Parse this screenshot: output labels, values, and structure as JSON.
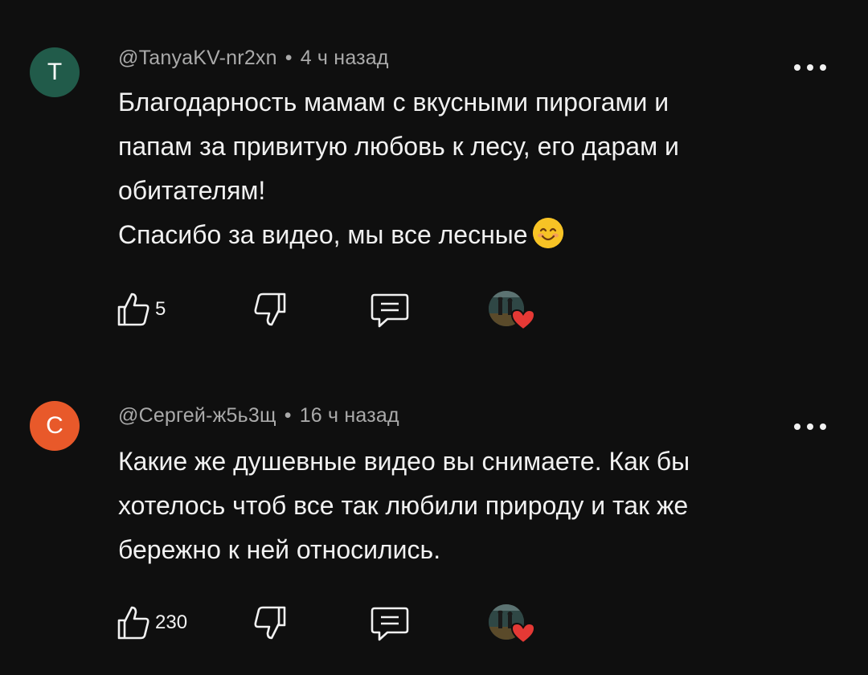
{
  "comments": [
    {
      "avatar_letter": "T",
      "avatar_color": "#215b4a",
      "author": "@TanyaKV-nr2xn",
      "separator": "•",
      "time": "4 ч назад",
      "lines": [
        "Благодарность мамам с вкусными пирогами и",
        "папам за привитую любовь к лесу, его дарам и",
        "обитателям!",
        "Спасибо за видео, мы все лесные"
      ],
      "emoji": "smiling-face-emoji",
      "likes": "5",
      "menu_icon": "more-vertical-icon",
      "like_icon": "thumbs-up-icon",
      "dislike_icon": "thumbs-down-icon",
      "reply_icon": "reply-icon"
    },
    {
      "avatar_letter": "C",
      "avatar_color": "#e8592a",
      "author": "@Сергей-ж5ь3щ",
      "separator": "•",
      "time": "16 ч назад",
      "lines": [
        "Какие же душевные видео вы снимаете. Как бы",
        "хотелось чтоб все так любили природу и так же",
        "бережно к ней относились."
      ],
      "likes": "230",
      "menu_icon": "more-vertical-icon",
      "like_icon": "thumbs-up-icon",
      "dislike_icon": "thumbs-down-icon",
      "reply_icon": "reply-icon"
    }
  ],
  "colors": {
    "background": "#0f0f0f",
    "text": "#f1f1f1",
    "meta": "#aaaaaa",
    "heart": "#e53935"
  }
}
